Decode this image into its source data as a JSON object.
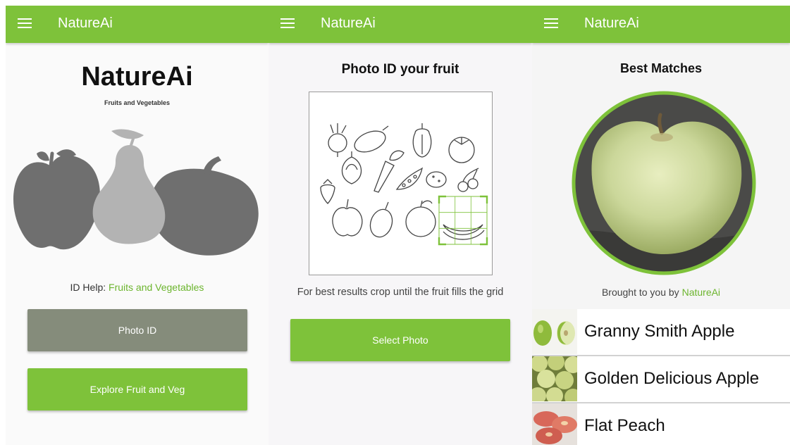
{
  "screens": [
    {
      "appbar": {
        "title": "NatureAi",
        "menu_icon": "menu-icon"
      },
      "logo_title": "NatureAi",
      "logo_subtitle": "Fruits and Vegetables",
      "help_label": "ID Help:",
      "help_link": "Fruits and Vegetables",
      "buttons": {
        "photo_id": "Photo ID",
        "explore": "Explore Fruit and Veg"
      }
    },
    {
      "appbar": {
        "title": "NatureAi",
        "menu_icon": "menu-icon"
      },
      "heading": "Photo ID your fruit",
      "hint": "For best results crop until the fruit fills the grid",
      "buttons": {
        "select_photo": "Select Photo"
      }
    },
    {
      "appbar": {
        "title": "NatureAi",
        "menu_icon": "menu-icon"
      },
      "heading": "Best Matches",
      "brought_label": "Brought to you by",
      "brand": "NatureAi",
      "matches": [
        {
          "name": "Granny Smith Apple"
        },
        {
          "name": "Golden Delicious Apple"
        },
        {
          "name": "Flat Peach"
        }
      ]
    }
  ],
  "colors": {
    "brand_green": "#7ec23a",
    "link_green": "#6cb52e",
    "photo_button_gray": "#858c7b",
    "fruit_gray": "#6f6f6f"
  }
}
